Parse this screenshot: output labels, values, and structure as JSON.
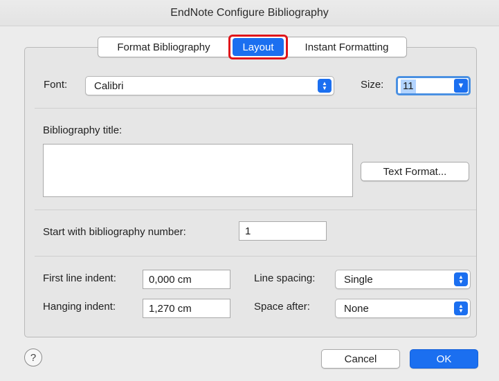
{
  "window": {
    "title": "EndNote Configure Bibliography"
  },
  "tabs": [
    {
      "label": "Format Bibliography"
    },
    {
      "label": "Layout",
      "selected": true
    },
    {
      "label": "Instant Formatting"
    }
  ],
  "font": {
    "label": "Font:",
    "value": "Calibri"
  },
  "size": {
    "label": "Size:",
    "value": "11"
  },
  "bibliography_title": {
    "label": "Bibliography title:",
    "value": "",
    "text_format_button": "Text Format..."
  },
  "start_number": {
    "label": "Start with bibliography number:",
    "value": "1"
  },
  "first_line_indent": {
    "label": "First line indent:",
    "value": "0,000 cm"
  },
  "hanging_indent": {
    "label": "Hanging indent:",
    "value": "1,270 cm"
  },
  "line_spacing": {
    "label": "Line spacing:",
    "value": "Single"
  },
  "space_after": {
    "label": "Space after:",
    "value": "None"
  },
  "buttons": {
    "help": "?",
    "cancel": "Cancel",
    "ok": "OK"
  },
  "colors": {
    "accent": "#1b6ff0",
    "highlight_ring": "#e0141a",
    "focus_ring": "#4a90e2"
  },
  "icons": [
    "updown-arrows-icon",
    "chevron-down-icon",
    "help-icon"
  ]
}
